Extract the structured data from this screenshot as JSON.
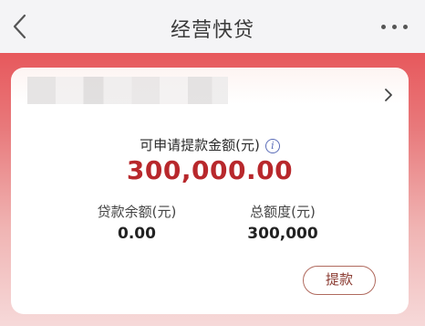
{
  "nav": {
    "title": "经营快贷"
  },
  "card": {
    "available_label": "可申请提款金额(元)",
    "available_amount": "300,000.00",
    "loan_balance_label": "贷款余额(元)",
    "loan_balance_value": "0.00",
    "total_limit_label": "总额度(元)",
    "total_limit_value": "300,000",
    "withdraw_label": "提款"
  },
  "colors": {
    "accent_red": "#b8282c",
    "header_gradient_top": "#e7585c"
  },
  "icons": [
    "back-arrow-icon",
    "more-dots-icon",
    "chevron-right-icon",
    "info-icon"
  ]
}
